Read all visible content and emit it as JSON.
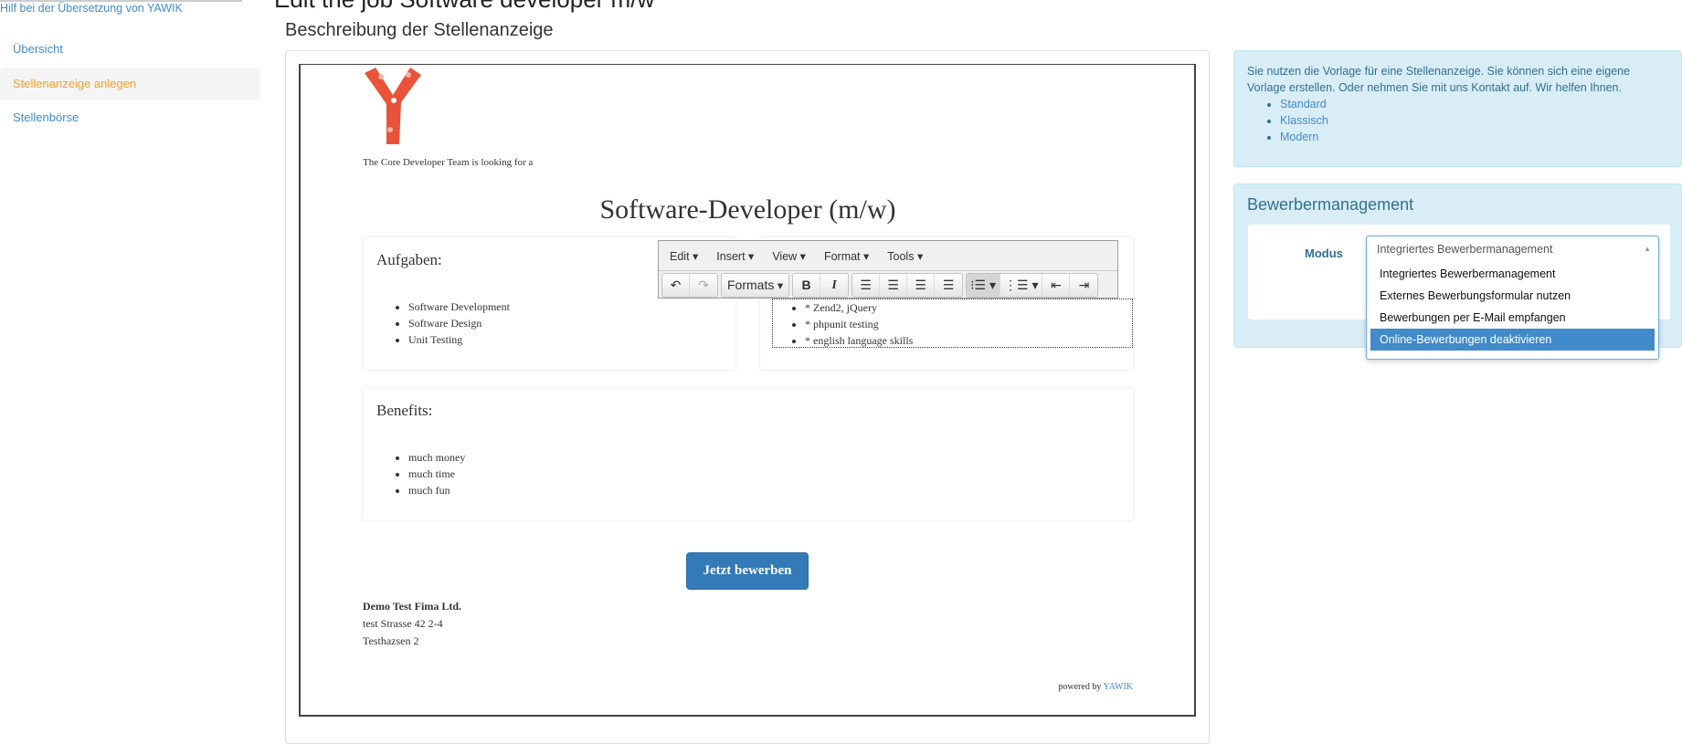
{
  "sidebar": {
    "help_link": "Hilf bei der Übersetzung von YAWIK",
    "items": [
      {
        "label": "Übersicht"
      },
      {
        "label": "Stellenanzeige anlegen",
        "active": true
      },
      {
        "label": "Stellenbörse"
      }
    ]
  },
  "page": {
    "title": "Edit the job Software developer m/w",
    "section_title": "Beschreibung der Stellenanzeige"
  },
  "job": {
    "intro": "The Core Developer Team is looking for a",
    "headline": "Software-Developer (m/w)",
    "tasks": {
      "title": "Aufgaben:",
      "items": [
        "Software Development",
        "Software Design",
        "Unit Testing"
      ]
    },
    "qualifications": {
      "items": [
        "* Zend2, jQuery",
        "* phpunit testing",
        "* english language skills"
      ]
    },
    "benefits": {
      "title": "Benefits:",
      "items": [
        "much money",
        "much time",
        "much fun"
      ]
    },
    "apply_button": "Jetzt bewerben",
    "company": {
      "name": "Demo Test Fima Ltd.",
      "street": "test Strasse 42 2-4",
      "city": "Testhazsen 2"
    },
    "powered_by": "powered by",
    "powered_link": "YAWIK"
  },
  "editor": {
    "menus": [
      "Edit",
      "Insert",
      "View",
      "Format",
      "Tools"
    ],
    "formats_label": "Formats"
  },
  "info": {
    "text": "Sie nutzen die Vorlage für eine Stellenanzeige. Sie können sich eine eigene Vorlage erstellen. Oder nehmen Sie mit uns Kontakt auf. Wir helfen Ihnen.",
    "templates": [
      "Standard",
      "Klassisch",
      "Modern"
    ]
  },
  "applicant_mgmt": {
    "title": "Bewerbermanagement",
    "mode_label": "Modus",
    "selected": "Integriertes Bewerbermanagement",
    "options": [
      "Integriertes Bewerbermanagement",
      "Externes Bewerbungsformular nutzen",
      "Bewerbungen per E-Mail empfangen",
      "Online-Bewerbungen deaktivieren"
    ],
    "highlighted_index": 3
  },
  "colors": {
    "accent": "#428bca",
    "active_nav": "#f0a030",
    "info_bg": "#d9edf7",
    "button": "#337ab7"
  }
}
